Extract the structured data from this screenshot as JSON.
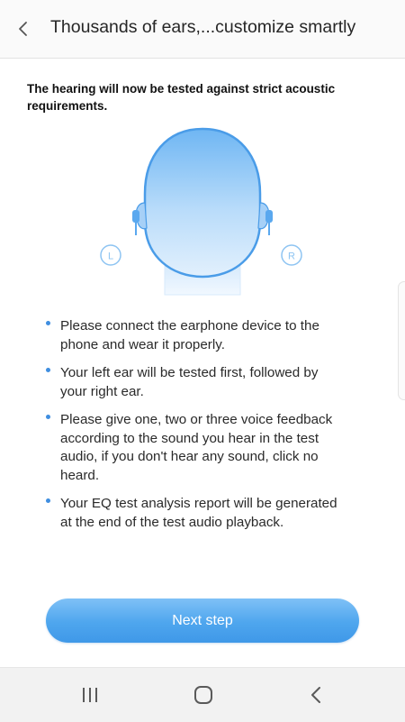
{
  "header": {
    "title": "Thousands of ears,...customize smartly",
    "back_icon": "chevron-left-icon"
  },
  "intro": "The hearing will now be tested against strict acoustic requirements.",
  "illustration": {
    "left_label": "L",
    "right_label": "R",
    "accent_color": "#5aa8ef"
  },
  "instructions": [
    "Please connect the earphone device to the phone and wear it properly.",
    "Your left ear will be tested first, followed by your right ear.",
    "Please give one, two or three voice feedback according to the sound you hear in the test audio, if you don't hear any sound, click no heard.",
    "Your EQ test analysis report will be generated at the end of the test audio playback."
  ],
  "next_button": "Next step",
  "navbar": {
    "recents_icon": "recent-apps-icon",
    "home_icon": "home-icon",
    "back_icon": "back-icon"
  }
}
